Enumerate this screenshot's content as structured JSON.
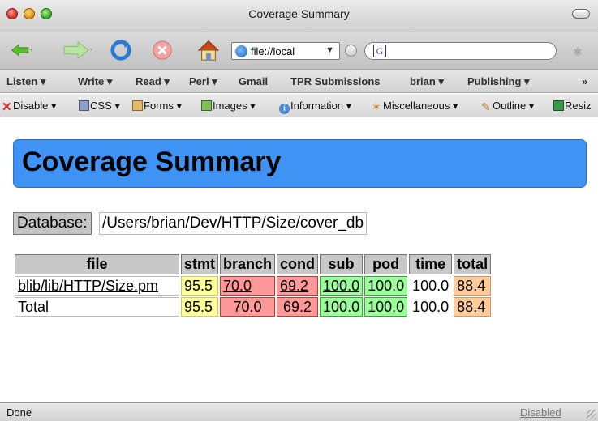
{
  "window": {
    "title": "Coverage Summary"
  },
  "toolbar": {
    "address": "file://local",
    "address_dropdown": "▼",
    "search_engine_letter": "G"
  },
  "bookmarks": [
    {
      "label": "Listen ▾"
    },
    {
      "label": "Write ▾"
    },
    {
      "label": "Read ▾"
    },
    {
      "label": "Perl ▾"
    },
    {
      "label": "Gmail"
    },
    {
      "label": "TPR Submissions"
    },
    {
      "label": "brian ▾"
    },
    {
      "label": "Publishing ▾"
    },
    {
      "label": "»"
    }
  ],
  "devbar": [
    {
      "label": "Disable ▾"
    },
    {
      "label": "CSS ▾"
    },
    {
      "label": "Forms ▾"
    },
    {
      "label": "Images ▾"
    },
    {
      "label": "Information ▾"
    },
    {
      "label": "Miscellaneous ▾"
    },
    {
      "label": "Outline ▾"
    },
    {
      "label": "Resiz"
    }
  ],
  "page": {
    "heading": "Coverage Summary",
    "database_label": "Database:",
    "database_path": "/Users/brian/Dev/HTTP/Size/cover_db"
  },
  "table": {
    "headers": [
      "file",
      "stmt",
      "branch",
      "cond",
      "sub",
      "pod",
      "time",
      "total"
    ],
    "rows": [
      {
        "file": "blib/lib/HTTP/Size.pm",
        "stmt": "95.5",
        "branch": "70.0",
        "cond": "69.2",
        "sub": "100.0",
        "pod": "100.0",
        "time": "100.0",
        "total": "88.4"
      },
      {
        "file": "Total",
        "stmt": "95.5",
        "branch": "70.0",
        "cond": "69.2",
        "sub": "100.0",
        "pod": "100.0",
        "time": "100.0",
        "total": "88.4"
      }
    ],
    "colors": {
      "stmt": "#ffff99",
      "branch": "#ff9999",
      "cond": "#ff9999",
      "sub": "#99ff99",
      "pod": "#99ff99",
      "time": "#ffffff",
      "total": "#ffcc99"
    }
  },
  "status": {
    "text": "Done",
    "right": "Disabled"
  }
}
